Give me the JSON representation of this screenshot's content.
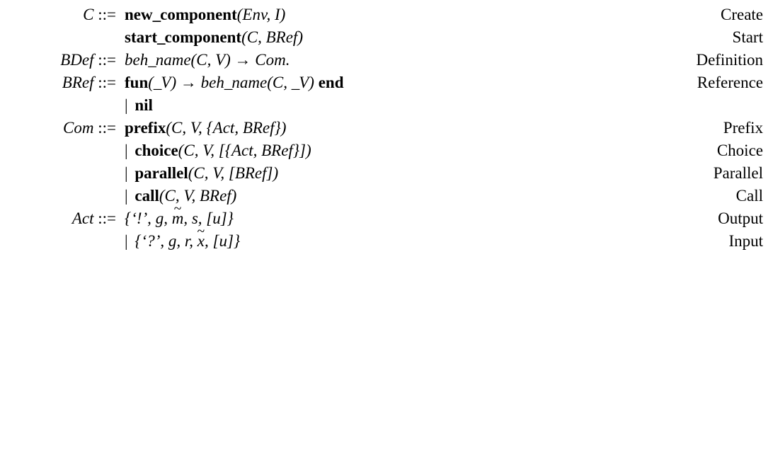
{
  "rows": [
    {
      "lhs": "C ::=",
      "mid": {
        "type": "plain",
        "bold": "new_component",
        "rest": "(Env, I)"
      },
      "rhs": "Create"
    },
    {
      "lhs": "",
      "mid": {
        "type": "plain",
        "bold": "start_component",
        "rest": "(C, BRef)"
      },
      "rhs": "Start"
    },
    {
      "lhs": "BDef ::=",
      "mid": {
        "type": "ital",
        "text": "beh_name(C, V) → Com."
      },
      "rhs": "Definition"
    },
    {
      "lhs": "BRef ::=",
      "mid": {
        "type": "ref"
      },
      "rhs": "Reference"
    },
    {
      "lhs": "",
      "mid": {
        "type": "bar",
        "bold": "nil",
        "rest": ""
      },
      "rhs": ""
    },
    {
      "lhs": "Com ::=",
      "mid": {
        "type": "plain",
        "bold": "prefix",
        "rest": "(C, V, {Act, BRef})"
      },
      "rhs": "Prefix"
    },
    {
      "lhs": "",
      "mid": {
        "type": "bar",
        "bold": "choice",
        "rest": "(C, V, [{Act, BRef}])"
      },
      "rhs": "Choice"
    },
    {
      "lhs": "",
      "mid": {
        "type": "bar",
        "bold": "parallel",
        "rest": "(C, V, [BRef])"
      },
      "rhs": "Parallel"
    },
    {
      "lhs": "",
      "mid": {
        "type": "bar",
        "bold": "call",
        "rest": "(C, V, BRef)"
      },
      "rhs": "Call"
    },
    {
      "lhs": "Act ::=",
      "mid": {
        "type": "act1"
      },
      "rhs": "Output"
    },
    {
      "lhs": "",
      "mid": {
        "type": "act2"
      },
      "rhs": "Input"
    }
  ]
}
